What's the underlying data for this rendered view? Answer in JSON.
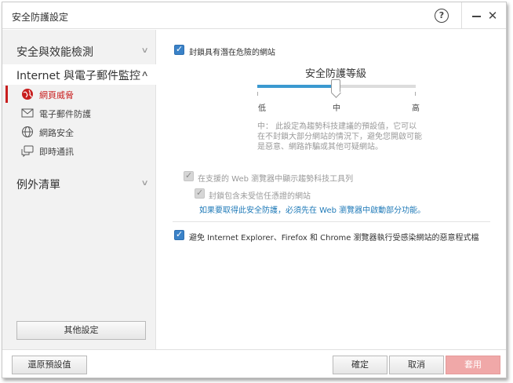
{
  "window": {
    "title": "安全防護設定",
    "help_label": "?",
    "close_label": "✕"
  },
  "sidebar": {
    "sections": [
      {
        "label": "安全與效能檢測"
      },
      {
        "label": "Internet 與電子郵件監控"
      },
      {
        "label": "例外清單"
      }
    ],
    "sub_items": [
      {
        "label": "網頁威脅",
        "icon": "globe-threat-icon"
      },
      {
        "label": "電子郵件防護",
        "icon": "envelope-icon"
      },
      {
        "label": "網路安全",
        "icon": "network-globe-icon"
      },
      {
        "label": "即時通訊",
        "icon": "chat-bubble-icon"
      }
    ],
    "other_settings_label": "其他設定"
  },
  "main": {
    "block_sites_label": "封鎖具有潛在危險的網站",
    "security_level": {
      "title": "安全防護等級",
      "low": "低",
      "medium": "中",
      "high": "高",
      "value": 0.5
    },
    "description": "中： 此設定為趨勢科技建議的預設值，它可以在不封鎖大部分網站的情況下，避免您開啟可能是惡意、網路詐騙或其他可疑網站。",
    "toolbar_label": "在支援的 Web 瀏覽器中顯示趨勢科技工具列",
    "block_untested_label": "封鎖包含未受信任憑證的網站",
    "web_protect_link": "如果要取得此安全防護，必須先在 Web 瀏覽器中啟動部分功能。",
    "malicious_script_label": "避免 Internet Explorer、Firefox 和 Chrome 瀏覽器執行受感染網站的惡意程式檔"
  },
  "footer": {
    "restore_label": "還原預設值",
    "ok_label": "確定",
    "cancel_label": "取消",
    "apply_label": "套用"
  },
  "colors": {
    "accent": "#3b99d0",
    "active": "#c81e1e",
    "apply": "#f0a8a8"
  }
}
